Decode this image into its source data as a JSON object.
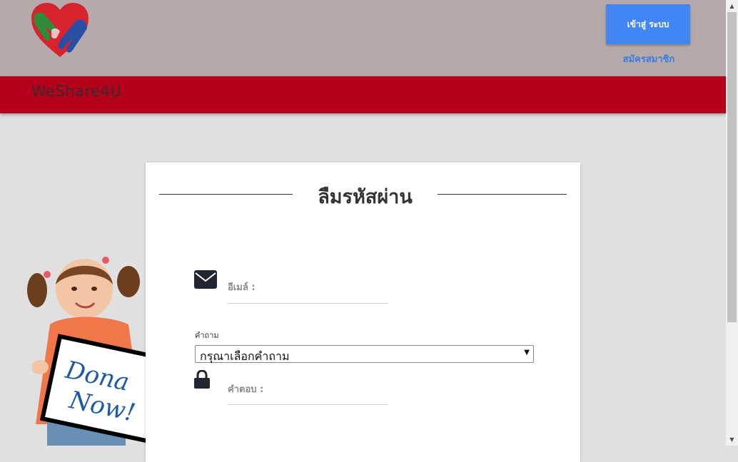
{
  "header": {
    "login_label": "เข้าสู่ ระบบ",
    "register_label": "สมัครสมาชิก",
    "brand_name": "WeShare4U",
    "colors": {
      "topbar": "#b5a9ab",
      "brandbar": "#b5001c",
      "accent": "#4285f4"
    }
  },
  "illustration": {
    "sign_text_line1": "Dona",
    "sign_text_line2": "Now!"
  },
  "form": {
    "title": "ลืมรหัสผ่าน",
    "email_label": "อีเมล์ :",
    "email_value": "",
    "question_label": "คำถาม",
    "question_selected": "กรุณาเลือกคำถาม",
    "answer_label": "คำตอบ :",
    "answer_value": ""
  },
  "icons": [
    "logo-heart-hands-icon",
    "mail-icon",
    "lock-icon",
    "chevron-down-icon"
  ]
}
